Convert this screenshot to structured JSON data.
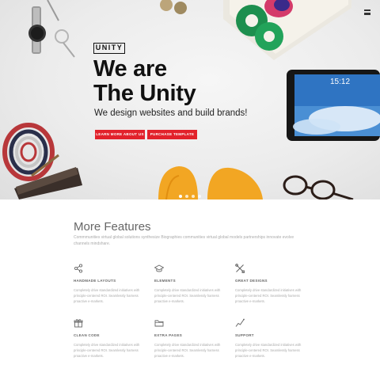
{
  "hero": {
    "logo": "UNITY",
    "headline_line1": "We are",
    "headline_line2": "The Unity",
    "tagline": "We design websites and build brands!",
    "buttons": {
      "learn": "LEARN MORE ABOUT US",
      "purchase": "PURCHASE TEMPLATE"
    },
    "tablet_time": "15:12",
    "slider_count": 4,
    "slider_active": 1
  },
  "features": {
    "title": "More Features",
    "description": "Commmunities virtual global solutions synthesize Biographies communities virtual global models partnerships innovate evolve channels mindshare.",
    "items": [
      {
        "icon": "share-icon",
        "title": "HANDMADE LAYOUTS",
        "text": "Completely drive standardized initiatives with principle-centered ROI. Seamlessly harness proactive e-markets."
      },
      {
        "icon": "graduation-cap-icon",
        "title": "ELEMENTS",
        "text": "Completely drive standardized initiatives with principle-centered ROI. Seamlessly harness proactive e-markets."
      },
      {
        "icon": "tools-icon",
        "title": "GREAT DESIGNS",
        "text": "Completely drive standardized initiatives with principle-centered ROI. Seamlessly harness proactive e-markets."
      },
      {
        "icon": "gift-icon",
        "title": "CLEAN CODE",
        "text": "Completely drive standardized initiatives with principle-centered ROI. Seamlessly harness proactive e-markets."
      },
      {
        "icon": "folder-icon",
        "title": "EXTRA PAGES",
        "text": "Completely drive standardized initiatives with principle-centered ROI. Seamlessly harness proactive e-markets."
      },
      {
        "icon": "chart-line-icon",
        "title": "SUPPORT",
        "text": "Completely drive standardized initiatives with principle-centered ROI. Seamlessly harness proactive e-markets."
      }
    ]
  },
  "colors": {
    "accent": "#e2222b",
    "heading": "#111111",
    "muted": "#aaaaaa"
  }
}
